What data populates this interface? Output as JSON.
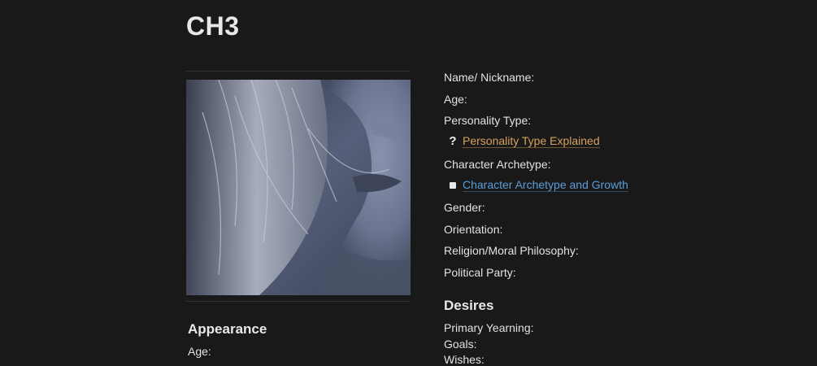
{
  "page": {
    "title": "CH3"
  },
  "profile": {
    "fields": {
      "name": "Name/ Nickname:",
      "age": "Age:",
      "personality_type": "Personality Type:",
      "character_archetype": "Character Archetype:",
      "gender": "Gender:",
      "orientation": "Orientation:",
      "religion": "Religion/Moral Philosophy:",
      "political_party": "Political Party:"
    },
    "links": {
      "personality": {
        "icon": "question-mark-icon",
        "label": "Personality Type Explained",
        "color": "#d6a35e"
      },
      "archetype": {
        "icon": "square-icon",
        "label": "Character Archetype and Growth",
        "color": "#5a9ed8"
      }
    }
  },
  "desires": {
    "heading": "Desires",
    "primary_yearning": "Primary Yearning:",
    "goals": "Goals:",
    "wishes": "Wishes:"
  },
  "appearance": {
    "heading": "Appearance",
    "age": "Age:"
  }
}
